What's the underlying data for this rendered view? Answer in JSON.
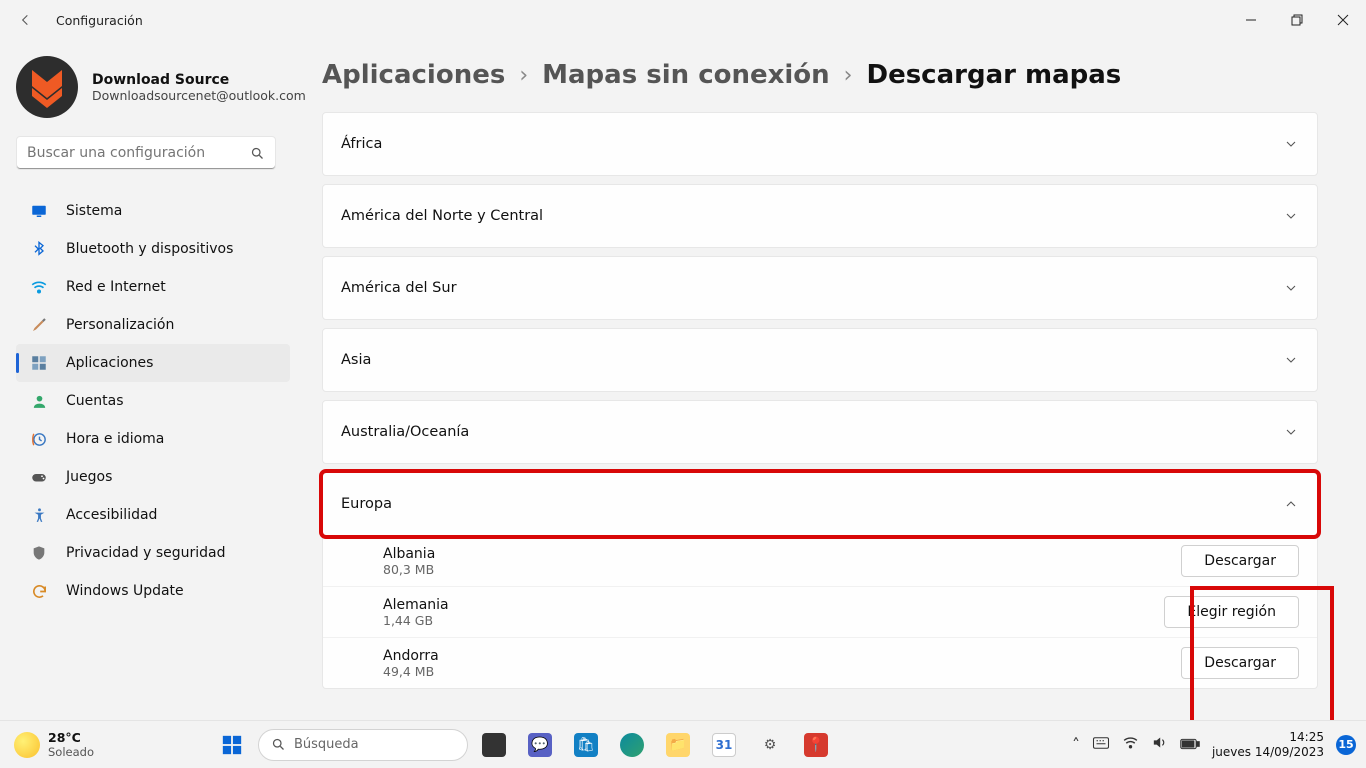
{
  "window": {
    "title": "Configuración"
  },
  "account": {
    "name": "Download Source",
    "email": "Downloadsourcenet@outlook.com"
  },
  "search": {
    "placeholder": "Buscar una configuración"
  },
  "sidebar": {
    "items": [
      {
        "label": "Sistema"
      },
      {
        "label": "Bluetooth y dispositivos"
      },
      {
        "label": "Red e Internet"
      },
      {
        "label": "Personalización"
      },
      {
        "label": "Aplicaciones"
      },
      {
        "label": "Cuentas"
      },
      {
        "label": "Hora e idioma"
      },
      {
        "label": "Juegos"
      },
      {
        "label": "Accesibilidad"
      },
      {
        "label": "Privacidad y seguridad"
      },
      {
        "label": "Windows Update"
      }
    ]
  },
  "breadcrumb": {
    "a": "Aplicaciones",
    "b": "Mapas sin conexión",
    "c": "Descargar mapas"
  },
  "continents": [
    {
      "label": "África"
    },
    {
      "label": "América del Norte y Central"
    },
    {
      "label": "América del Sur"
    },
    {
      "label": "Asia"
    },
    {
      "label": "Australia/Oceanía"
    },
    {
      "label": "Europa"
    }
  ],
  "europa_rows": [
    {
      "name": "Albania",
      "size": "80,3 MB",
      "button": "Descargar"
    },
    {
      "name": "Alemania",
      "size": "1,44 GB",
      "button": "Elegir región"
    },
    {
      "name": "Andorra",
      "size": "49,4 MB",
      "button": "Descargar"
    }
  ],
  "taskbar": {
    "weather_temp": "28°C",
    "weather_desc": "Soleado",
    "search_placeholder": "Búsqueda",
    "clock_time": "14:25",
    "clock_date": "jueves 14/09/2023",
    "notif_count": "15"
  }
}
